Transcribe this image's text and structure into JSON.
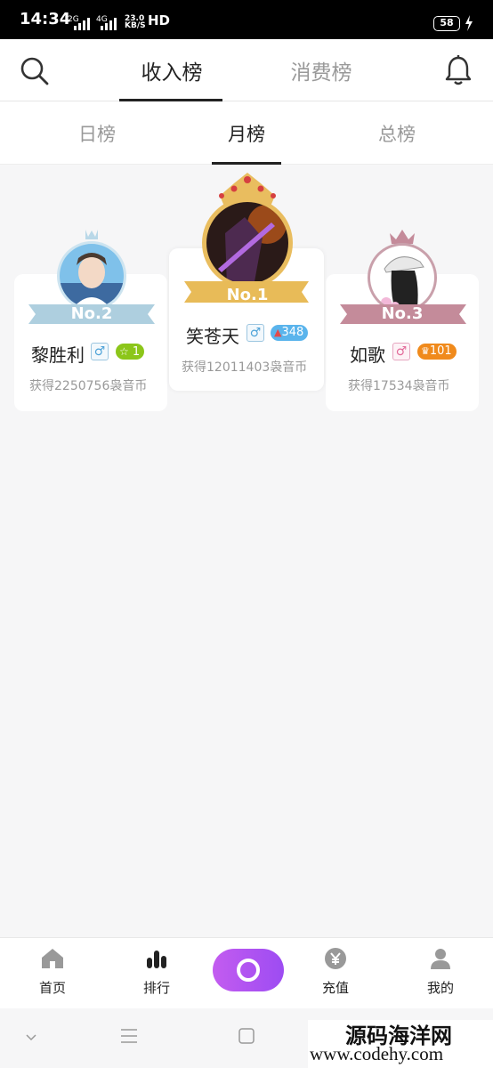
{
  "status": {
    "time": "14:34",
    "net1": "2G",
    "net2": "4G",
    "speed_value": "23.0",
    "speed_unit": "KB/S",
    "hd": "HD",
    "battery": "58"
  },
  "header": {
    "tabs": [
      {
        "label": "收入榜",
        "active": true
      },
      {
        "label": "消费榜",
        "active": false
      }
    ]
  },
  "subtabs": [
    {
      "label": "日榜"
    },
    {
      "label": "月榜"
    },
    {
      "label": "总榜"
    }
  ],
  "podium": [
    {
      "rank_label": "No.1",
      "name": "笑苍天",
      "gender": "♂",
      "badge": "348",
      "badge_color": "#5ab4ec",
      "earn": "获得12011403袅音币"
    },
    {
      "rank_label": "No.2",
      "name": "黎胜利",
      "gender": "♂",
      "badge": "1",
      "badge_color": "#8cc61a",
      "earn": "获得2250756袅音币"
    },
    {
      "rank_label": "No.3",
      "name": "如歌",
      "gender": "♂",
      "badge": "101",
      "badge_color": "#f08a1c",
      "earn": "获得17534袅音币"
    }
  ],
  "colors": {
    "gold": "#e8bb58",
    "silver": "#aecfdf",
    "rose": "#c48b9a",
    "accent": "#a956f2"
  },
  "bottom_nav": [
    {
      "label": "首页",
      "icon": "home-icon"
    },
    {
      "label": "排行",
      "icon": "ranking-icon"
    },
    {
      "label": "充值",
      "icon": "yen-coin-icon"
    },
    {
      "label": "我的",
      "icon": "user-icon"
    }
  ],
  "watermark": {
    "line1": "源码海洋网",
    "line2": "www.codehy.com"
  }
}
